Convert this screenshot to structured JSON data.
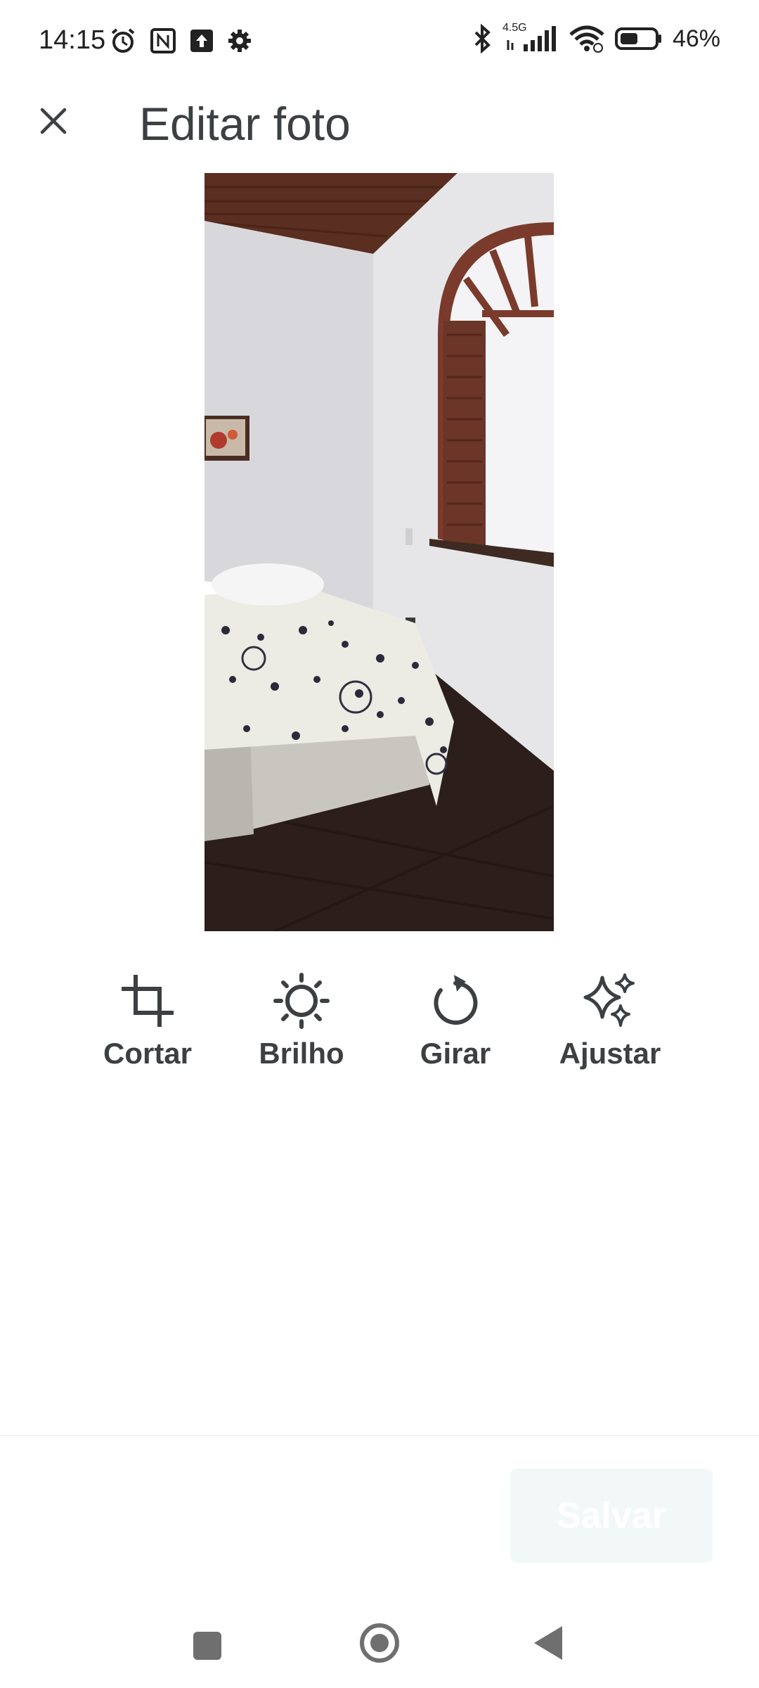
{
  "status_bar": {
    "time": "14:15",
    "network_label": "4.5G",
    "battery_percent": "46%",
    "icons_left": [
      "alarm-icon",
      "nfc-icon",
      "upload-icon",
      "settings-icon"
    ],
    "icons_right": [
      "bluetooth-icon",
      "signal-icon",
      "wifi-icon",
      "battery-icon"
    ]
  },
  "app_bar": {
    "title": "Editar foto",
    "close_icon": "close-icon"
  },
  "tools": [
    {
      "label": "Cortar",
      "icon": "crop-icon"
    },
    {
      "label": "Brilho",
      "icon": "brightness-icon"
    },
    {
      "label": "Girar",
      "icon": "rotate-icon"
    },
    {
      "label": "Ajustar",
      "icon": "sparkle-icon"
    }
  ],
  "footer": {
    "save_label": "Salvar",
    "save_enabled": false
  },
  "colors": {
    "text_primary": "#3c4043",
    "save_button_bg": "#f1f8f7",
    "nav_icon": "#6f6f6f"
  }
}
